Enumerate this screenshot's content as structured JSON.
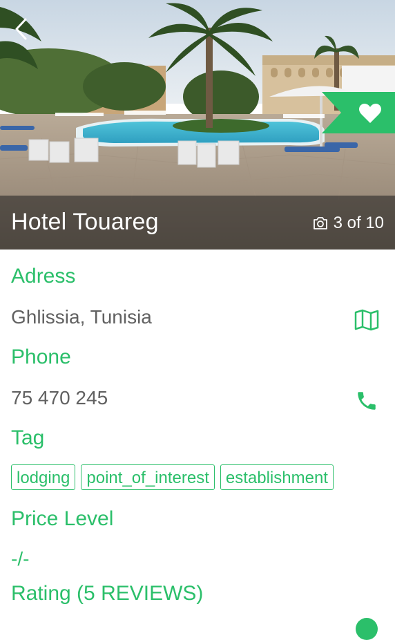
{
  "hero": {
    "hotel_name": "Hotel Touareg",
    "photo_counter": "3 of 10",
    "favorite_color": "#2bbf6a"
  },
  "address": {
    "label": "Adress",
    "value": "Ghlissia, Tunisia",
    "icon": "map-icon"
  },
  "phone": {
    "label": "Phone",
    "value": "75 470 245",
    "icon": "phone-icon"
  },
  "tag": {
    "label": "Tag",
    "items": [
      "lodging",
      "point_of_interest",
      "establishment"
    ]
  },
  "price_level": {
    "label": "Price Level",
    "value": "-/-"
  },
  "rating": {
    "label": "Rating (5 REVIEWS)"
  },
  "colors": {
    "accent": "#2bbf6a",
    "value_text": "#616161"
  }
}
